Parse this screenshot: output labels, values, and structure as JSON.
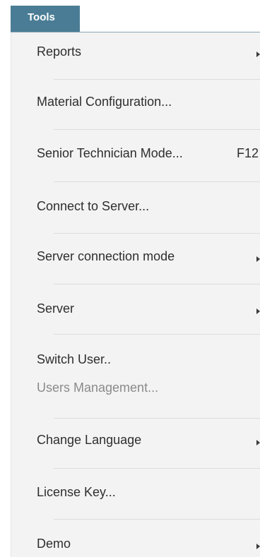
{
  "menubar": {
    "title": "Tools"
  },
  "menu": {
    "items": [
      {
        "label": "Reports"
      },
      {
        "label": "Material Configuration..."
      },
      {
        "label": "Senior Technician Mode...",
        "shortcut": "F12"
      },
      {
        "label": "Connect to Server..."
      },
      {
        "label": "Server connection mode"
      },
      {
        "label": "Server"
      },
      {
        "label": "Switch User.."
      },
      {
        "label": "Users Management..."
      },
      {
        "label": "Change Language"
      },
      {
        "label": "License Key..."
      },
      {
        "label": "Demo"
      }
    ]
  },
  "icons": {
    "submenu": "submenu-arrow-icon"
  },
  "colors": {
    "menu_title_bg": "#4a7d95",
    "dropdown_bg": "#f3f3f3",
    "disabled_text": "#8a8a8a"
  }
}
